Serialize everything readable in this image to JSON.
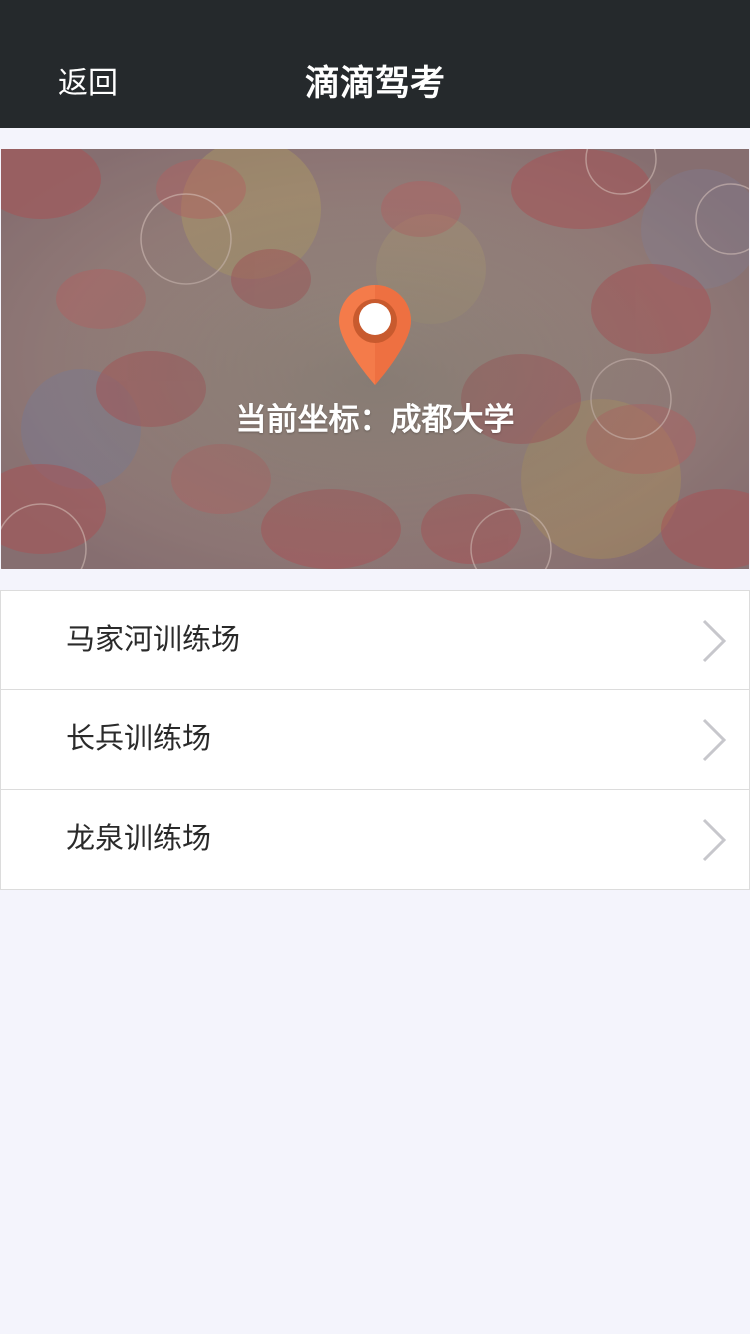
{
  "navbar": {
    "back_label": "返回",
    "title": "滴滴驾考"
  },
  "hero": {
    "location_text": "当前坐标：成都大学",
    "pin_icon": "map-pin-icon",
    "pin_color": "#f47b4a"
  },
  "training_grounds": [
    {
      "label": "马家河训练场",
      "icon": "chevron-right-icon"
    },
    {
      "label": "长兵训练场",
      "icon": "chevron-right-icon"
    },
    {
      "label": "龙泉训练场",
      "icon": "chevron-right-icon"
    }
  ],
  "colors": {
    "navbar": "#25292c",
    "background": "#f4f4fc",
    "divider": "#dcdcdc"
  }
}
